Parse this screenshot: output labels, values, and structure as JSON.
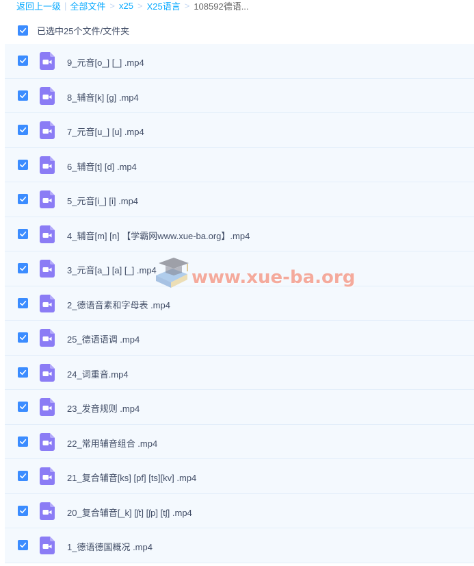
{
  "breadcrumb": {
    "back": "返回上一级",
    "items": [
      "全部文件",
      "x25",
      "X25语言",
      "108592德语..."
    ]
  },
  "selection": {
    "label": "已选中25个文件/文件夹"
  },
  "files": [
    "9_元音[o_] [_] .mp4",
    "8_辅音[k] [g] .mp4",
    "7_元音[u_] [u] .mp4",
    "6_辅音[t] [d] .mp4",
    "5_元音[i_] [i] .mp4",
    "4_辅音[m] [n] 【学霸网www.xue-ba.org】.mp4",
    "3_元音[a_] [a] [_] .mp4",
    "2_德语音素和字母表 .mp4",
    "25_德语语调 .mp4",
    "24_词重音.mp4",
    "23_发音规则 .mp4",
    "22_常用辅音组合 .mp4",
    "21_复合辅音[ks] [pf] [ts][kv] .mp4",
    "20_复合辅音[_k] [ʃt] [ʃp] [tʃ] .mp4",
    "1_德语德国概况 .mp4"
  ],
  "watermark": {
    "text": "www.xue-ba.org"
  },
  "colors": {
    "link": "#09aaff",
    "checkbox": "#3b8cff",
    "video_icon": "#8b7cf5",
    "row_bg": "#f4f9fe"
  }
}
